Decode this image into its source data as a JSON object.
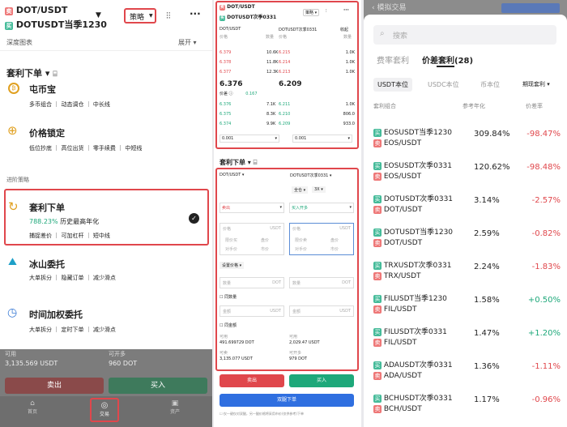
{
  "p1": {
    "pair1": "DOT/USDT",
    "pair2": "DOTUSDT当季1230",
    "strategy_btn": "策略",
    "depth_label": "深度图表",
    "expand_label": "展开",
    "arb_title": "套利下单",
    "items": [
      {
        "title": "屯币宝",
        "tags": "多币组合 ｜ 动态调仓 ｜ 中长线"
      },
      {
        "title": "价格锁定",
        "tags": "低位抄底 ｜ 高位出货 ｜ 零手续费 ｜ 中短线"
      }
    ],
    "advanced_label": "进阶策略",
    "arb_item": {
      "title": "套利下单",
      "rate": "788.23%",
      "rate_desc": "历史最高年化",
      "tags": "捕捉差价 ｜ 可加杠杆 ｜ 短中线"
    },
    "iceberg": {
      "title": "冰山委托",
      "tags": "大单拆分 ｜ 隐藏订单 ｜ 减少滑点"
    },
    "twap": {
      "title": "时间加权委托",
      "tags": "大单拆分 ｜ 定时下单 ｜ 减少滑点"
    },
    "avail_label": "可用",
    "avail_value": "3,135.569 USDT",
    "open_label": "可开多",
    "open_value": "960 DOT",
    "sell_btn": "卖出",
    "buy_btn": "买入",
    "nav": [
      "首页",
      "交易",
      "资产"
    ]
  },
  "p2": {
    "pair1": "DOT/USDT",
    "pair2": "DOTUSDT次季0331",
    "strategy_btn": "策略",
    "col_a": "DOT/USDT",
    "col_b": "DOTUSDT次季0331",
    "col_c": "收起",
    "sub_a": "价格",
    "sub_b": "数量",
    "sub_c": "价格",
    "sub_d": "数量",
    "asks": [
      [
        "6.379",
        "10.6K",
        "6.215",
        "1.0K"
      ],
      [
        "6.378",
        "11.8K",
        "6.214",
        "1.0K"
      ],
      [
        "6.377",
        "12.3K",
        "6.213",
        "1.0K"
      ]
    ],
    "mid_a": "6.376",
    "mid_b": "6.209",
    "spread_label": "价差",
    "spread_val": "0.167",
    "bids": [
      [
        "6.376",
        "7.1K",
        "6.211",
        "1.0K"
      ],
      [
        "6.375",
        "8.3K",
        "6.210",
        "806.0"
      ],
      [
        "6.374",
        "9.9K",
        "6.209",
        "933.0"
      ]
    ],
    "depth_a": "0.001",
    "depth_b": "0.001",
    "arb_title": "套利下单",
    "form_pair_a": "DOT/USDT",
    "form_pair_b": "DOTUSDT次季0331",
    "margin": "全仓",
    "lev": "3X",
    "side_a": "卖出",
    "side_b": "买入开多",
    "price_label": "价格",
    "unit_usdt": "USDT",
    "qp": [
      "限价买",
      "盘价",
      "对手价",
      "市价"
    ],
    "qp2": [
      "限价卖",
      "盘价",
      "对手价",
      "市价"
    ],
    "set_price": "设置价格",
    "qty_label": "数量",
    "unit_dot": "DOT",
    "same_qty": "同数量",
    "amount_label": "金额",
    "same_amount": "同金额",
    "avail_a_label": "可用",
    "avail_a": "491.699729 DOT",
    "avail_b_label": "可用",
    "avail_b": "2,029.47 USDT",
    "can_a_label": "可卖",
    "can_a": "3,135.077 USDT",
    "can_b_label": "可开多",
    "can_b": "979 DOT",
    "sell_btn": "卖出",
    "buy_btn": "买入",
    "dual_btn": "双腿下单",
    "note": "仅一键仅对双腿，另一腿价格将采用市价(仅供参考)下单"
  },
  "p3": {
    "header": "模拟交易",
    "search_placeholder": "搜索",
    "tabs": [
      "费率套利",
      "价差套利(28)"
    ],
    "sub_tabs": [
      "USDT本位",
      "USDC本位",
      "币本位",
      "期现套利"
    ],
    "col1": "套利组合",
    "col2": "参考年化",
    "col3": "价差率",
    "rows": [
      {
        "a": "EOSUSDT当季1230",
        "b": "EOS/USDT",
        "ann": "309.84%",
        "spread": "-98.47%"
      },
      {
        "a": "EOSUSDT次季0331",
        "b": "EOS/USDT",
        "ann": "120.62%",
        "spread": "-98.48%"
      },
      {
        "a": "DOTUSDT次季0331",
        "b": "DOT/USDT",
        "ann": "3.14%",
        "spread": "-2.57%"
      },
      {
        "a": "DOTUSDT当季1230",
        "b": "DOT/USDT",
        "ann": "2.59%",
        "spread": "-0.82%"
      },
      {
        "a": "TRXUSDT次季0331",
        "b": "TRX/USDT",
        "ann": "2.24%",
        "spread": "-1.83%"
      },
      {
        "a": "FILUSDT当季1230",
        "b": "FIL/USDT",
        "ann": "1.58%",
        "spread": "+0.50%"
      },
      {
        "a": "FILUSDT次季0331",
        "b": "FIL/USDT",
        "ann": "1.47%",
        "spread": "+1.20%"
      },
      {
        "a": "ADAUSDT次季0331",
        "b": "ADA/USDT",
        "ann": "1.36%",
        "spread": "-1.11%"
      },
      {
        "a": "BCHUSDT次季0331",
        "b": "BCH/USDT",
        "ann": "1.17%",
        "spread": "-0.96%"
      }
    ],
    "sell_tag": "卖",
    "buy_tag": "买"
  }
}
